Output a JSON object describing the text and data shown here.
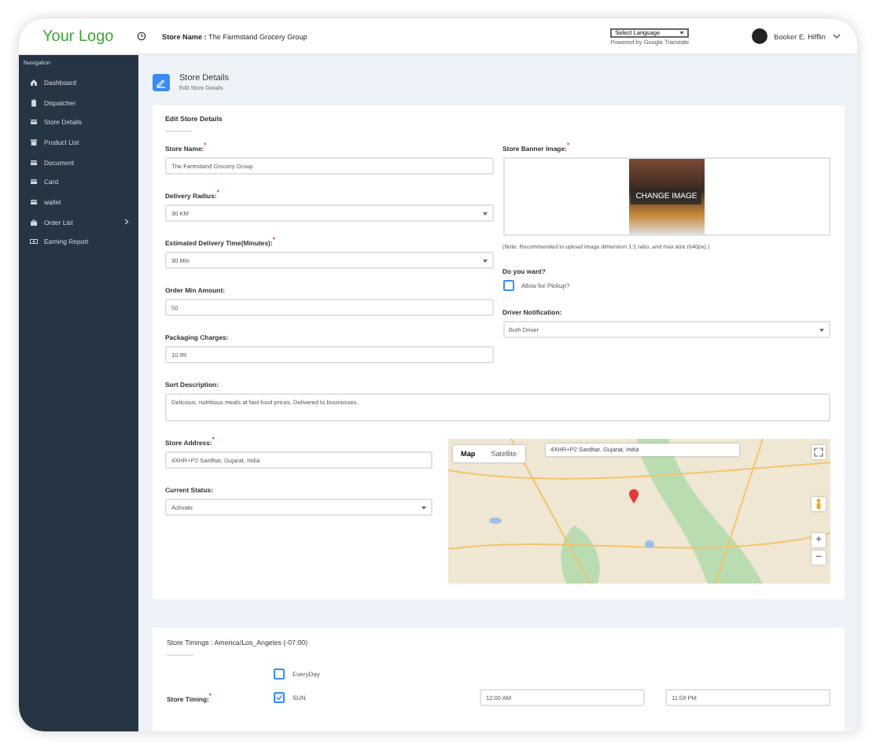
{
  "header": {
    "logo": "Your Logo",
    "store_name": "**Store Name :** The Farmstand Grocery Group",
    "language_select": "Select Language",
    "powered_by": "Powered by Google Translate",
    "user_name": "Booker E. Hifflin"
  },
  "sidebar": {
    "heading": "Navigation",
    "items": [
      {
        "label": "Dashboard",
        "selected": false,
        "has_submenu": false
      },
      {
        "label": "Dispatcher",
        "selected": false,
        "has_submenu": false
      },
      {
        "label": "Store Details",
        "selected": false,
        "has_submenu": false
      },
      {
        "label": "Product List",
        "selected": false,
        "has_submenu": false
      },
      {
        "label": "Document",
        "selected": false,
        "has_submenu": false
      },
      {
        "label": "Card",
        "selected": false,
        "has_submenu": false
      },
      {
        "label": "wallet",
        "selected": false,
        "has_submenu": false
      },
      {
        "label": "Order List",
        "selected": false,
        "has_submenu": true
      },
      {
        "label": "Earning Report",
        "selected": false,
        "has_submenu": false
      }
    ]
  },
  "page": {
    "title": "Store Details",
    "subtitle": "Edit Store Details"
  },
  "form": {
    "title": "Edit Store Details",
    "left_fields": [
      {
        "label": "Store Name:$^{*}$",
        "kind": "input",
        "value": "The Farmstand Grocery Group"
      },
      {
        "label": "Delivery Radius:$^{*}$",
        "kind": "select",
        "value": "30 KM"
      },
      {
        "label": "Estimated Delivery Time(Minutes):$^{*}$",
        "kind": "select",
        "value": "30 Min"
      },
      {
        "label": "Order Min Amount:",
        "kind": "input",
        "value": "50"
      },
      {
        "label": "Packaging Charges:",
        "kind": "input",
        "value": "10.99"
      }
    ],
    "banner": {
      "label": "Store Banner Image:$^{*}$",
      "button": "CHANGE IMAGE",
      "note": "(Note: Recommended to upload image dimension 1:1 ratio, and max size (640px).)"
    },
    "pickup": {
      "label": "Do you want?",
      "option": "Allow for Pickup?",
      "checked": false
    },
    "driver_notification": {
      "label": "Driver Notification:",
      "value": "Both Driver"
    },
    "description": {
      "label": "Sort Description:",
      "value": "Delicious, nutritious meals at fast-food prices. Delivered to businesses."
    },
    "address": {
      "label": "Store Address:$^{*}$",
      "value": "4XHR+P2 Sardhar, Gujarat, India"
    },
    "status": {
      "label": "Current Status:",
      "value": "Activate"
    },
    "map": {
      "tabs": [
        {
          "label": "Map",
          "selected": true
        },
        {
          "label": "Satellite",
          "selected": false
        }
      ],
      "search": "4XHR+P2 Sardhar, Gujarat, India",
      "zoom_in": "+",
      "zoom_out": "−"
    }
  },
  "timings": {
    "title": "Store Timings : America/Los_Angeles (-07:00)",
    "label": "Store Timing:$^{*}$",
    "days": [
      {
        "label": "EveryDay",
        "checked": false
      },
      {
        "label": "SUN",
        "checked": true,
        "open": "12:00 AM",
        "close": "11:59 PM"
      }
    ]
  }
}
